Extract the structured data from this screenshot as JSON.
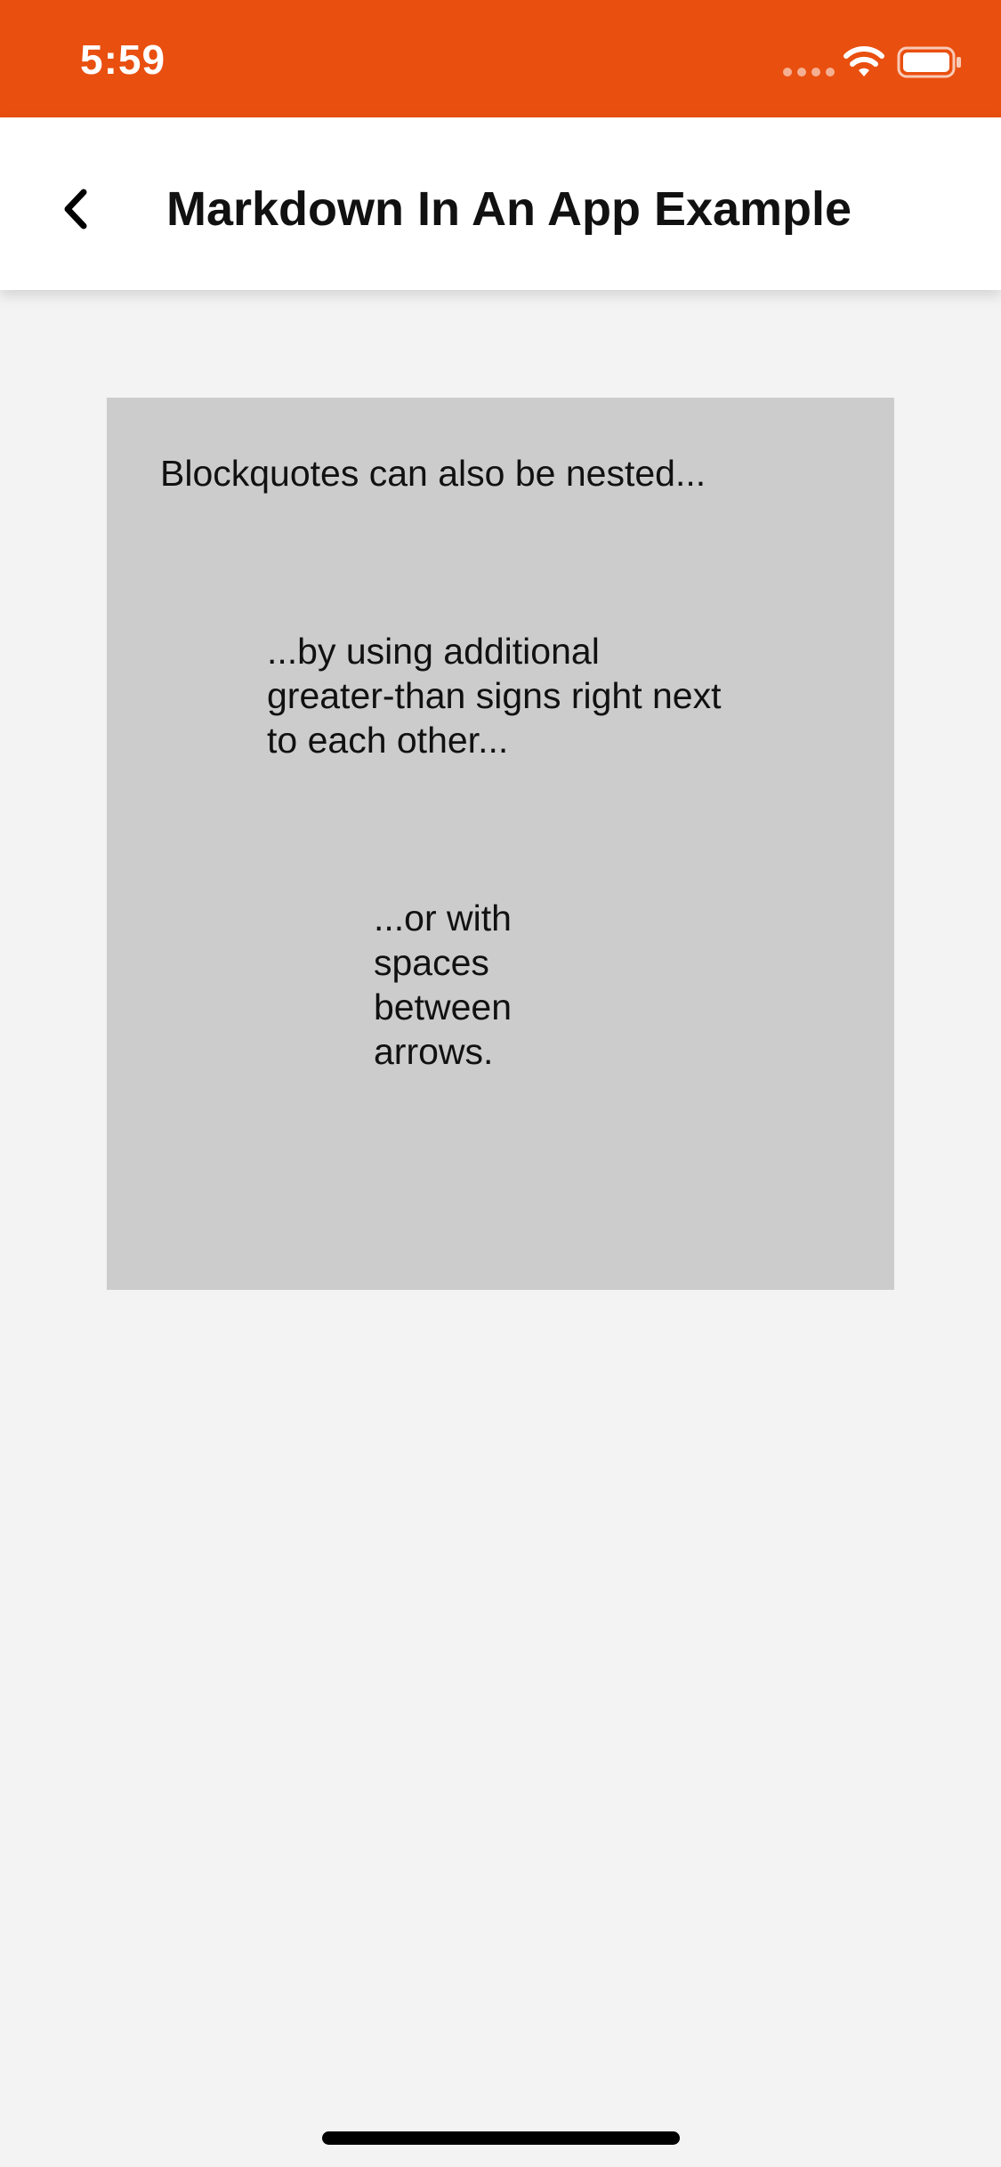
{
  "status_bar": {
    "time": "5:59",
    "background_color": "#e94f0f",
    "icons": [
      "signal-icon",
      "wifi-icon",
      "battery-icon"
    ]
  },
  "nav": {
    "back_icon": "chevron-left-icon",
    "title": "Markdown In An App Example"
  },
  "blockquote": {
    "background_color": "#cccccc",
    "level1": "Blockquotes can also be nested...",
    "level2": "...by using additional greater-than signs right next to each other...",
    "level3": "...or with spaces between arrows."
  }
}
